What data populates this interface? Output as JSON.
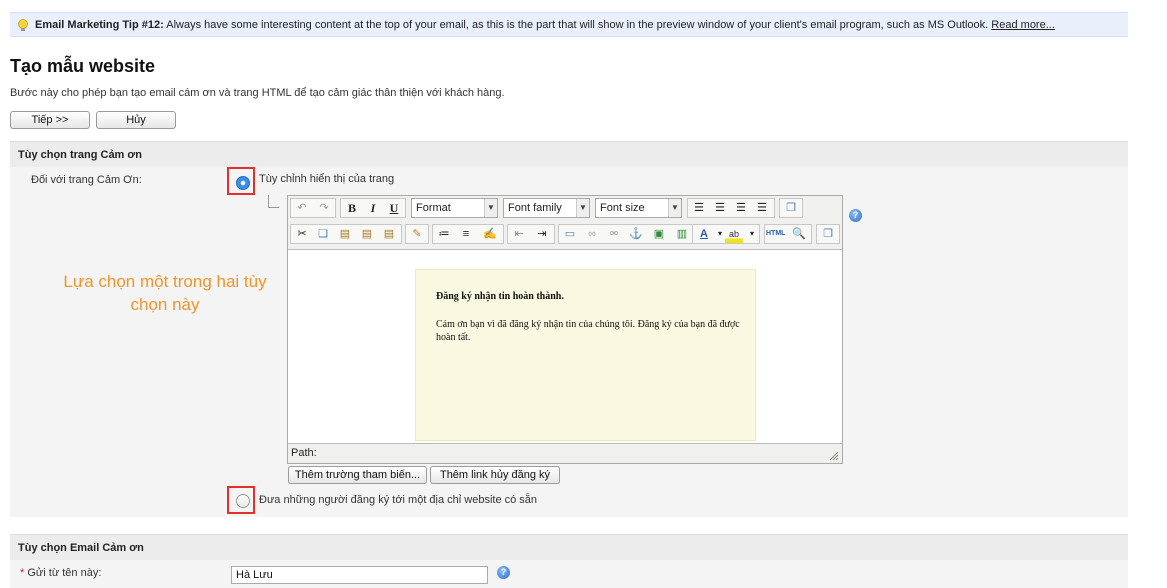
{
  "tip": {
    "label": "Email Marketing Tip #12:",
    "text": " Always have some interesting content at the top of your email, as this is the part that will show in the preview window of your client's email program, such as MS Outlook. ",
    "link": "Read more..."
  },
  "page": {
    "title": "Tạo mẫu website",
    "description": "Bước này cho phép bạn tạo email cám ơn và trang HTML để tạo cảm giác thân thiện với khách hàng."
  },
  "actions": {
    "next_label": "Tiếp >>",
    "cancel_label": "Hủy"
  },
  "thankyou_page": {
    "section_title": "Tùy chọn trang Cảm ơn",
    "field_label": "Đối với trang Cảm Ơn:",
    "option_custom": "Tùy chỉnh hiển thị của trang",
    "option_redirect": "Đưa những người đăng ký tới một địa chỉ website có sẵn",
    "selected": "custom"
  },
  "editor": {
    "format_label": "Format",
    "font_family_label": "Font family",
    "font_size_label": "Font size",
    "content_title": "Đăng ký nhận tin hoàn thành.",
    "content_body": "Cảm ơn bạn vì đã đăng ký nhận tin của chúng tôi. Đăng ký của bạn đã được hoàn tất.",
    "path_label": "Path:",
    "insert_field_button": "Thêm trường tham biến...",
    "insert_unsubscribe_button": "Thêm link hủy đăng ký"
  },
  "annotation": {
    "text": "Lựa chọn một trong hai tùy chọn này"
  },
  "thankyou_email": {
    "section_title": "Tùy chọn Email Cảm ơn",
    "from_name_label": "Gửi từ tên này:",
    "required_marker": "*",
    "from_name_value": "Hà Lưu"
  },
  "icons": {
    "tip": "lightbulb-icon",
    "help": "help-icon"
  }
}
